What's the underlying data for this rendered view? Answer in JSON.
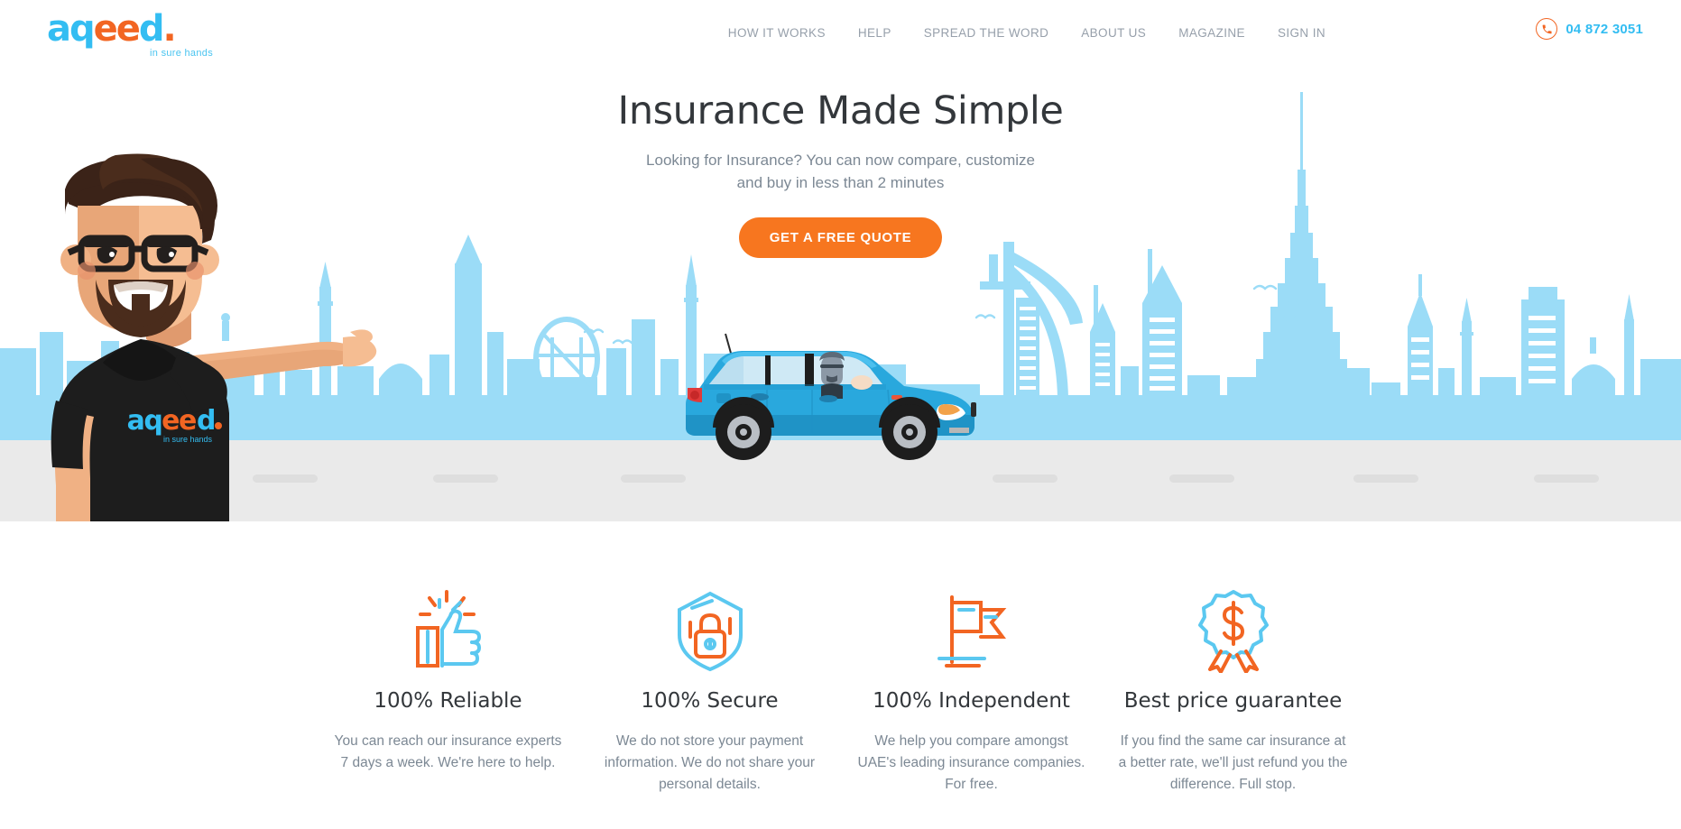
{
  "brand": {
    "logo_part_blue_1": "aq",
    "logo_part_orange": "ee",
    "logo_part_blue_2": "d",
    "logo_dot": ".",
    "tagline": "in sure hands",
    "accent_blue": "#33bdf2",
    "accent_orange": "#f26522",
    "cta_orange": "#f7761f",
    "sky_blue": "#9bdcf7",
    "ground_gray": "#eaeaea"
  },
  "header": {
    "nav_items": [
      {
        "label": "HOW IT WORKS",
        "name": "nav-how-it-works"
      },
      {
        "label": "HELP",
        "name": "nav-help"
      },
      {
        "label": "SPREAD THE WORD",
        "name": "nav-spread-the-word"
      },
      {
        "label": "ABOUT US",
        "name": "nav-about-us"
      },
      {
        "label": "MAGAZINE",
        "name": "nav-magazine"
      },
      {
        "label": "SIGN IN",
        "name": "nav-sign-in"
      }
    ],
    "phone": "04 872 3051",
    "phone_icon": "phone-icon"
  },
  "hero": {
    "title": "Insurance Made Simple",
    "subtitle_line_1": "Looking for Insurance? You can now compare, customize",
    "subtitle_line_2": "and buy in less than 2 minutes",
    "cta_label": "GET A FREE QUOTE",
    "illustration": {
      "character": "man-pointing-illustration",
      "vehicle": "blue-suv-car-illustration",
      "background": "dubai-skyline-silhouette",
      "shirt_logo": "aqeed"
    }
  },
  "features": [
    {
      "icon": "thumbs-up-icon",
      "title": "100% Reliable",
      "description": "You can reach our insurance experts 7 days a week. We're here to help."
    },
    {
      "icon": "shield-lock-icon",
      "title": "100% Secure",
      "description": "We do not store your payment information. We do not share your personal details."
    },
    {
      "icon": "flag-icon",
      "title": "100% Independent",
      "description": "We help you compare amongst UAE's leading insurance companies. For free."
    },
    {
      "icon": "dollar-badge-icon",
      "title": "Best price guarantee",
      "description": "If you find the same car insurance at a better rate, we'll just refund you the difference. Full stop."
    }
  ]
}
